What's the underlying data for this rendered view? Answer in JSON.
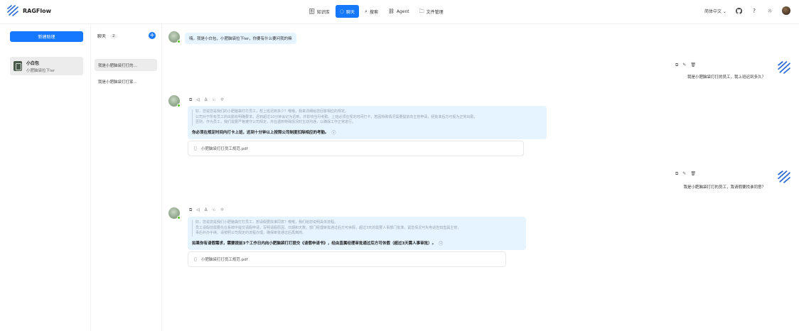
{
  "app": {
    "name": "RAGFlow"
  },
  "nav": [
    {
      "icon": "database-icon",
      "glyph": "🗄",
      "label": "知识库",
      "active": false
    },
    {
      "icon": "chat-icon",
      "glyph": "◌",
      "label": "聊天",
      "active": true
    },
    {
      "icon": "search-icon",
      "glyph": "⌕",
      "label": "搜索",
      "active": false
    },
    {
      "icon": "agent-icon",
      "glyph": "⛓",
      "label": "Agent",
      "active": false
    },
    {
      "icon": "folder-icon",
      "glyph": "🗀",
      "label": "文件管理",
      "active": false
    }
  ],
  "topright": {
    "language": "简体中文",
    "language_caret": "⌄",
    "github_glyph": "",
    "help_glyph": "?",
    "theme_glyph": "☼"
  },
  "left": {
    "new_assistant_label": "新建助理",
    "assistant": {
      "name": "小白包",
      "description": "小肥脑袋拉下ler"
    }
  },
  "middle": {
    "header_label": "聊天",
    "count": "2",
    "add_glyph": "+",
    "conversations": [
      {
        "title": "我是小肥脑袋打打的...",
        "selected": true
      },
      {
        "title": "我是小肥脑袋打打家...",
        "selected": false
      }
    ]
  },
  "chat": {
    "greeting": "嗨，我是小白包，小肥脑袋拉下ler，你要有什么要问我的嘛",
    "action_icons": {
      "copy": "⧉",
      "play": "◁",
      "thumbs_up": "♙",
      "thumbs_down": "♘",
      "bulb": "☼",
      "edit": "✎",
      "delete": "🗑"
    },
    "user_message_1": "我是小肥脑袋打打的员工，我上班迟到多久？",
    "answer_1": {
      "quote_lines": [
        "好，您说您是我们的小肥脑袋打打员工，想上班迟到多少？哦哦，我来详细给您回答相应的规定。",
        "公司对于所有员工的出勤有明确要求，迟到超过10分钟会记为迟到，并影响当月考勤。上班必须在规定时间打卡，若因特殊情况需要提前向主管申请，经批准后方可视为正常出勤，",
        "否则，作为员工，我们需要严格遵守公司规定，并在遇到特殊情况时主动沟通，以确保工作正常进行。"
      ],
      "main": "你必须在规定时间内打卡上班，迟到十分钟以上按照公司制度扣除相应的考勤。",
      "info_glyph": "ⓘ",
      "file": "小肥脑袋打打员工规范.pdf"
    },
    "user_message_2": "我是小肥脑袋打打的员工，我请假要找谁同意？",
    "answer_2": {
      "quote_lines": [
        "好，您说您是我们小肥脑袋打打员工，想请假要找谁同意？哦哦，我们给您说明具体流程。",
        "员工请假前需要先在系统中提交请假申请，写明请假原因、日期和天数。部门经理审批通过后方可休假，超过3天的需要人事部门批准，紧急情况可先电话告知直属主管，",
        "事后补办手续。请按照公司规定的流程办理，确保审批通过后再离岗。"
      ],
      "main": "如果你有请假需求，需要提前3个工作日内向小肥脑袋打打提交《请假申请书》，经由直属经理审批通过后方可休假（超过3天需人事审批）。",
      "info_glyph": "ⓘ",
      "file": "小肥脑袋打打员工规范.pdf"
    }
  }
}
